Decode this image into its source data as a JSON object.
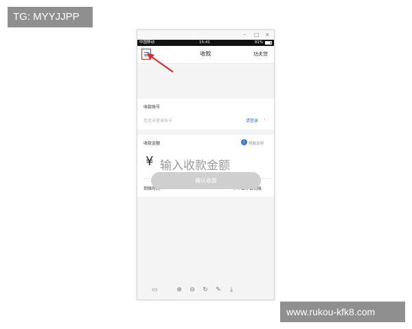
{
  "watermarks": {
    "top_left": "TG: MYYJJPP",
    "bottom_right": "www.rukou-kfk8.com"
  },
  "window": {
    "controls": [
      "–",
      "□",
      "×"
    ]
  },
  "statusbar": {
    "carrier": "中国移动",
    "time": "15:41",
    "battery": "91%"
  },
  "navbar": {
    "title": "收款",
    "right_action": "功夫贷"
  },
  "account": {
    "label": "收款账号",
    "placeholder": "您还未登录账号",
    "login_link": "请登录"
  },
  "amount": {
    "label": "收款金额",
    "info_link": "限额说明",
    "currency": "¥",
    "placeholder": "输入收款金额"
  },
  "arrival": {
    "label": "到账时间",
    "value": "下个工作日到账"
  },
  "confirm_button": "确认收款",
  "colors": {
    "accent": "#2f78d8",
    "highlight_box": "#e02a2a",
    "button_disabled": "#cfcfcf"
  },
  "toolbar_icons": [
    "image-icon",
    "zoom-in-icon",
    "zoom-out-icon",
    "rotate-icon",
    "edit-icon",
    "download-icon"
  ]
}
